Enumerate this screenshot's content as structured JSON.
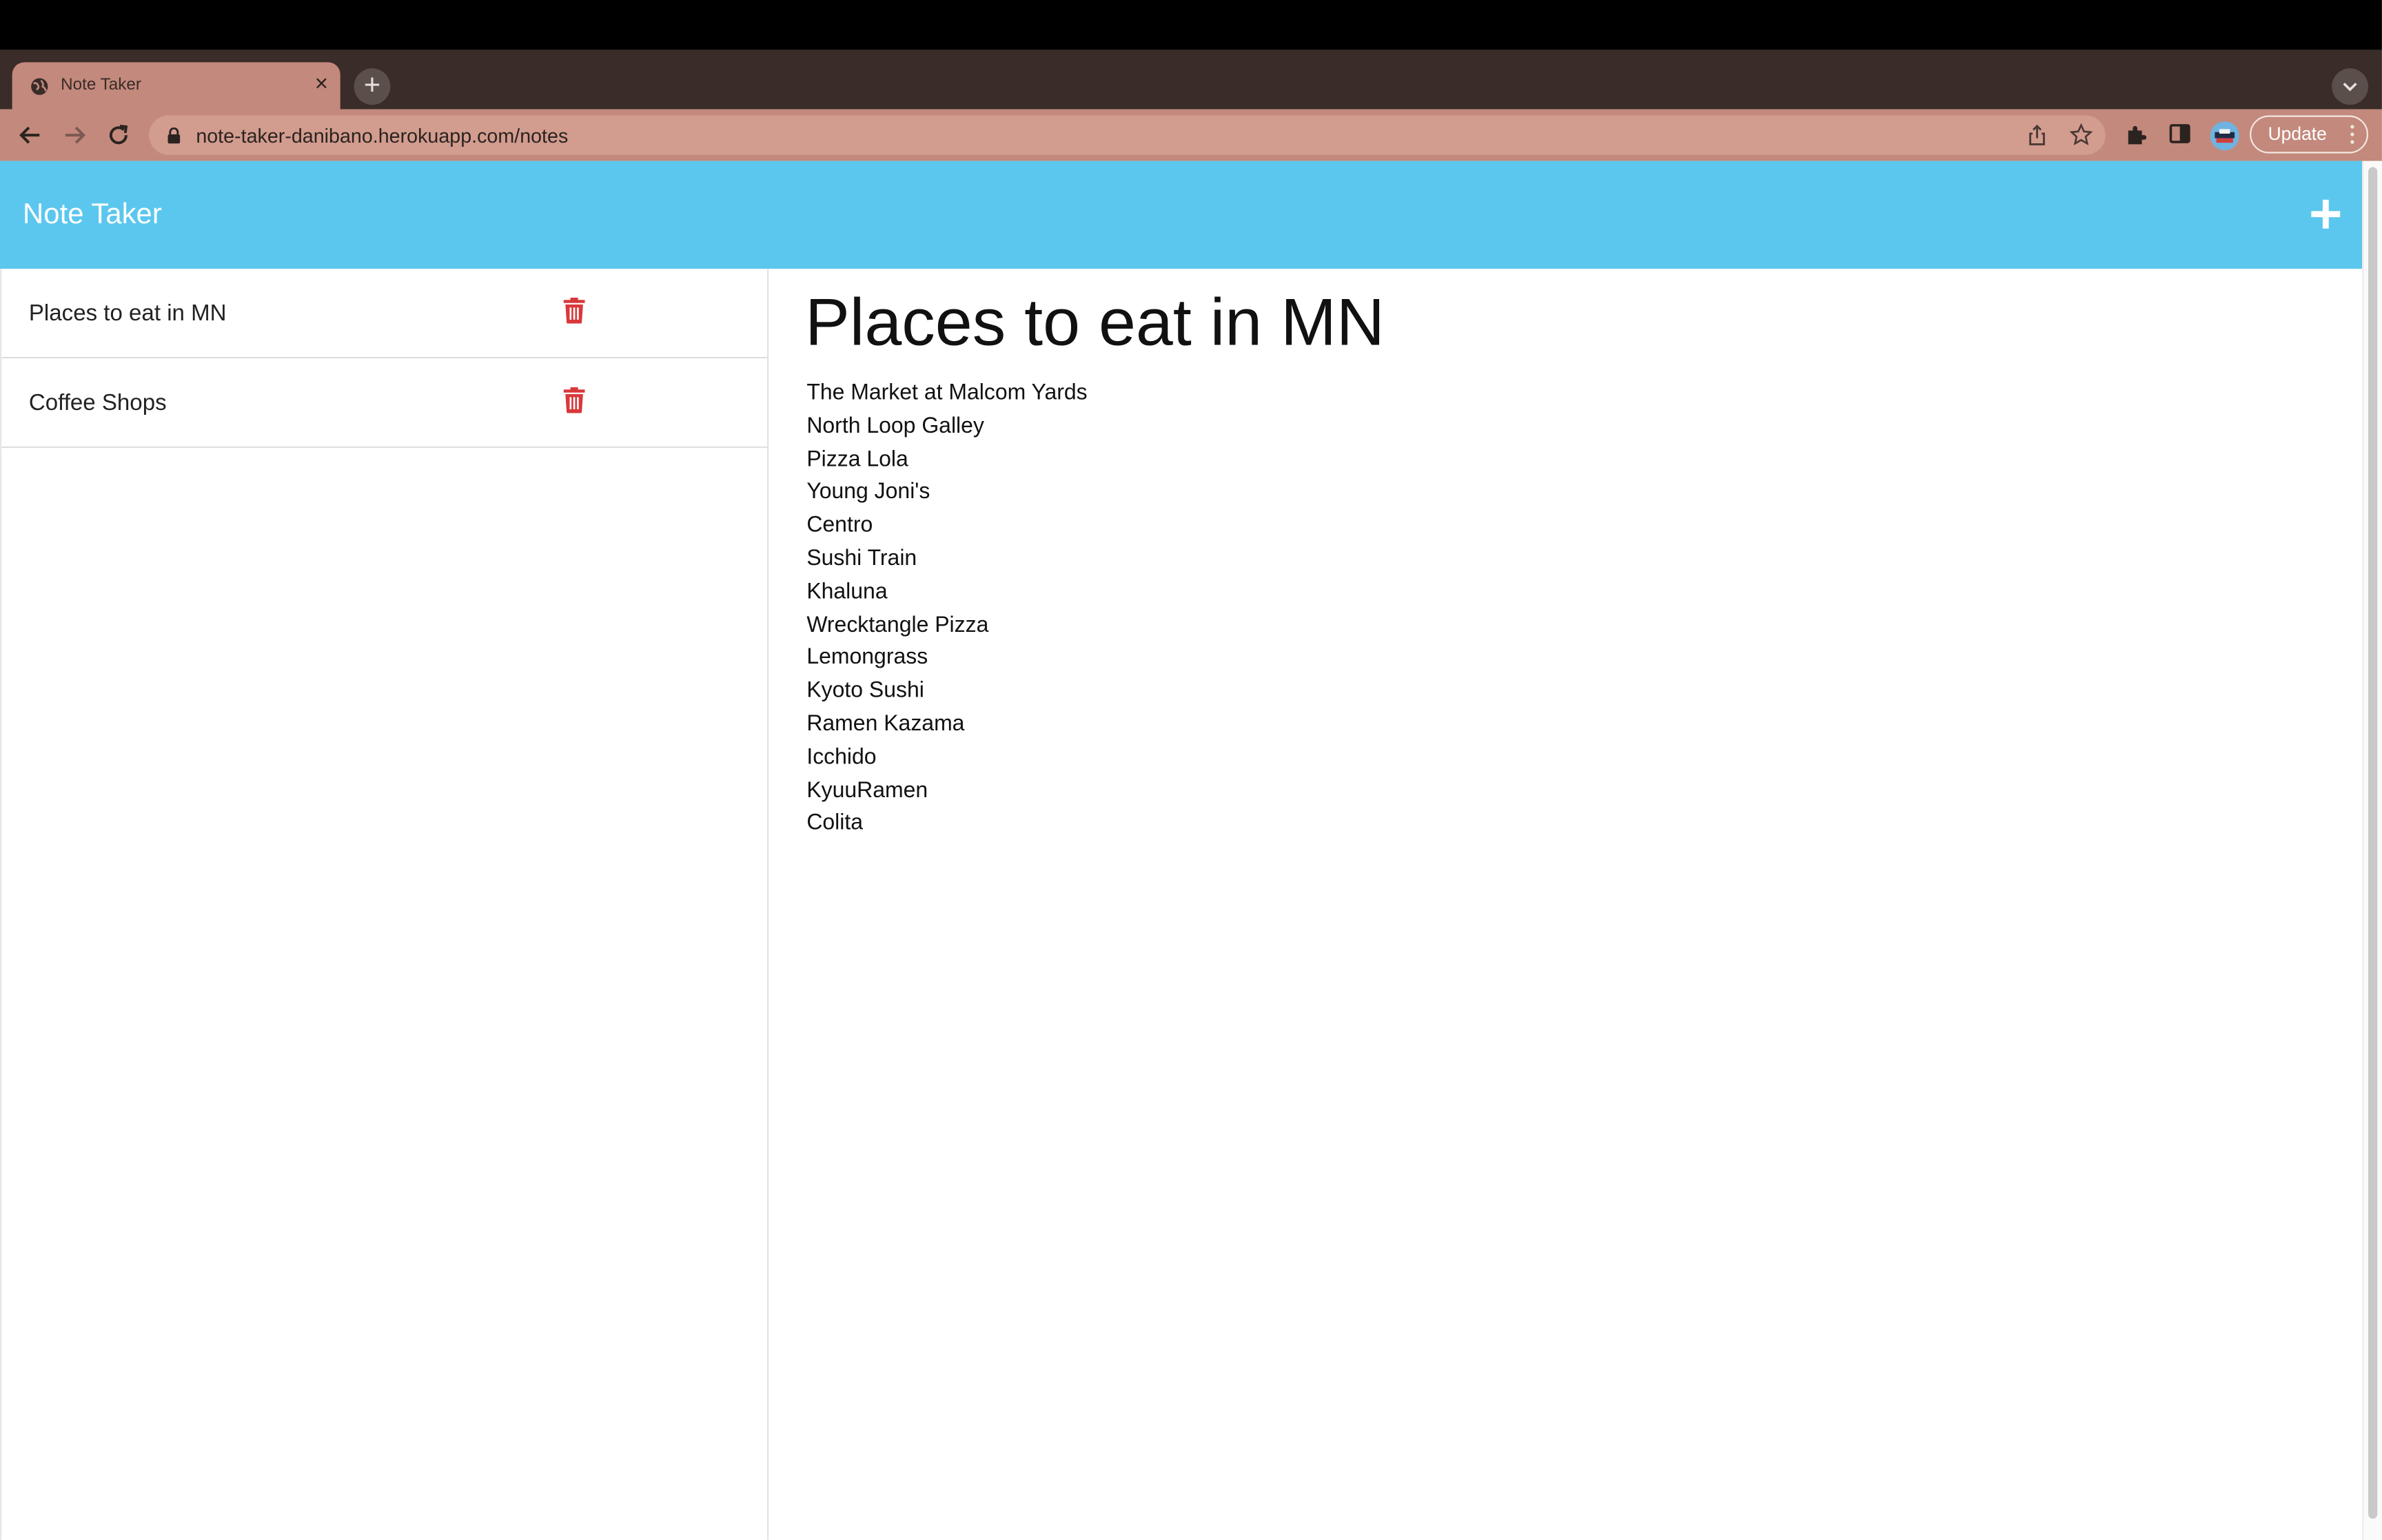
{
  "browser": {
    "tab_title": "Note Taker",
    "tab_close": "×",
    "new_tab": "+",
    "url": "note-taker-danibano.herokuapp.com/notes",
    "update_label": "Update"
  },
  "app": {
    "title": "Note Taker",
    "accent_color": "#5bc7ee",
    "delete_color": "#d9383a"
  },
  "sidebar": {
    "notes": [
      {
        "title": "Places to eat in MN"
      },
      {
        "title": "Coffee Shops"
      }
    ]
  },
  "note": {
    "title": "Places to eat in MN",
    "lines": [
      "The Market at Malcom Yards",
      "North Loop Galley",
      "Pizza Lola",
      "Young Joni's",
      "Centro",
      "Sushi Train",
      "Khaluna",
      "Wrecktangle Pizza",
      "Lemongrass",
      "Kyoto Sushi",
      "Ramen Kazama",
      "Icchido",
      "KyuuRamen",
      "Colita"
    ]
  }
}
